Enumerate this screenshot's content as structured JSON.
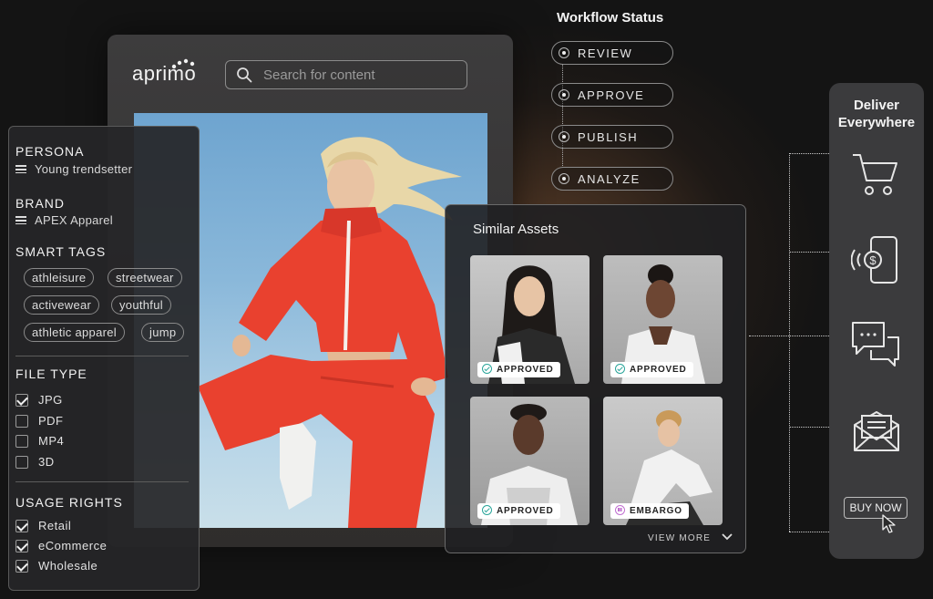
{
  "app": {
    "logo_text": "aprimo",
    "search_placeholder": "Search for content"
  },
  "filters": {
    "persona_heading": "PERSONA",
    "persona_value": "Young trendsetter",
    "brand_heading": "BRAND",
    "brand_value": "APEX Apparel",
    "smart_tags_heading": "SMART TAGS",
    "tags": [
      "athleisure",
      "streetwear",
      "activewear",
      "youthful",
      "athletic apparel",
      "jump"
    ],
    "file_type_heading": "FILE TYPE",
    "file_types": [
      {
        "label": "JPG",
        "checked": true
      },
      {
        "label": "PDF",
        "checked": false
      },
      {
        "label": "MP4",
        "checked": false
      },
      {
        "label": "3D",
        "checked": false
      }
    ],
    "usage_rights_heading": "USAGE RIGHTS",
    "usage_rights": [
      {
        "label": "Retail",
        "checked": true
      },
      {
        "label": "eCommerce",
        "checked": true
      },
      {
        "label": "Wholesale",
        "checked": true
      }
    ]
  },
  "workflow": {
    "title": "Workflow Status",
    "steps": [
      "REVIEW",
      "APPROVE",
      "PUBLISH",
      "ANALYZE"
    ]
  },
  "similar_assets": {
    "title": "Similar Assets",
    "items": [
      {
        "status": "APPROVED"
      },
      {
        "status": "APPROVED"
      },
      {
        "status": "APPROVED"
      },
      {
        "status": "EMBARGO"
      }
    ],
    "view_more": "VIEW MORE"
  },
  "deliver": {
    "title_line1": "Deliver",
    "title_line2": "Everywhere",
    "channels": [
      "shopping-cart-icon",
      "mobile-payment-icon",
      "chat-icon",
      "email-icon",
      "buy-now-button"
    ],
    "buy_now_label": "BUY NOW"
  },
  "colors": {
    "approved": "#2aa59a",
    "embargo": "#c070d0",
    "jacket": "#e9412f"
  }
}
